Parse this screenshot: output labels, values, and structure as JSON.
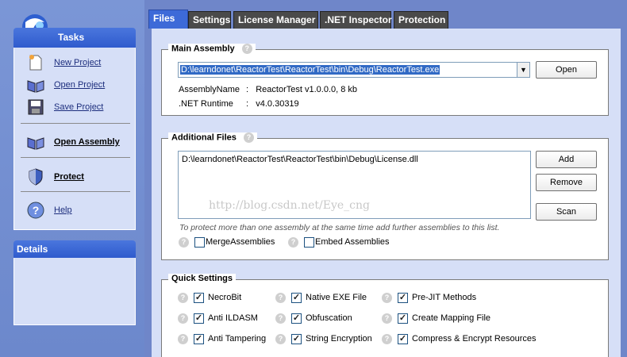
{
  "sidebar": {
    "tasks_title": "Tasks",
    "items": [
      {
        "label": "New Project",
        "icon": "new-project-icon"
      },
      {
        "label": "Open Project",
        "icon": "open-project-icon"
      },
      {
        "label": "Save Project",
        "icon": "save-project-icon"
      },
      {
        "label": "Open Assembly",
        "icon": "open-assembly-icon"
      },
      {
        "label": "Protect",
        "icon": "shield-icon"
      },
      {
        "label": "Help",
        "icon": "help-icon"
      }
    ],
    "details_title": "Details"
  },
  "tabs": [
    {
      "label": "Files",
      "active": true
    },
    {
      "label": "Settings"
    },
    {
      "label": "License Manager"
    },
    {
      "label": ".NET Inspector"
    },
    {
      "label": "Protection"
    }
  ],
  "main_assembly": {
    "title": "Main Assembly",
    "path": "D:\\learndonet\\ReactorTest\\ReactorTest\\bin\\Debug\\ReactorTest.exe",
    "open_label": "Open",
    "assembly_name_key": "AssemblyName",
    "assembly_name_value": "ReactorTest  v1.0.0.0,  8 kb",
    "runtime_key": ".NET Runtime",
    "runtime_value": "v4.0.30319",
    "separator": ":"
  },
  "additional_files": {
    "title": "Additional Files",
    "files": [
      "D:\\learndonet\\ReactorTest\\ReactorTest\\bin\\Debug\\License.dll"
    ],
    "add_label": "Add",
    "remove_label": "Remove",
    "scan_label": "Scan",
    "watermark": "http://blog.csdn.net/Eye_cng",
    "hint": "To protect more than one assembly at the same time add further assemblies to this list.",
    "merge_label": "MergeAssemblies",
    "embed_label": "Embed Assemblies"
  },
  "quick_settings": {
    "title": "Quick Settings",
    "options": [
      {
        "label": "NecroBit",
        "checked": true
      },
      {
        "label": "Native EXE File",
        "checked": true
      },
      {
        "label": "Pre-JIT Methods",
        "checked": true
      },
      {
        "label": "Anti ILDASM",
        "checked": true
      },
      {
        "label": "Obfuscation",
        "checked": true
      },
      {
        "label": "Create Mapping File",
        "checked": true
      },
      {
        "label": "Anti Tampering",
        "checked": true
      },
      {
        "label": "String Encryption",
        "checked": true
      },
      {
        "label": "Compress & Encrypt Resources",
        "checked": true
      }
    ]
  },
  "colors": {
    "tab_active": "#3d6ad8",
    "tab_inactive": "#4a4a4a",
    "panel_bg": "#d6dff7",
    "header_blue": "#2f5bcd"
  }
}
